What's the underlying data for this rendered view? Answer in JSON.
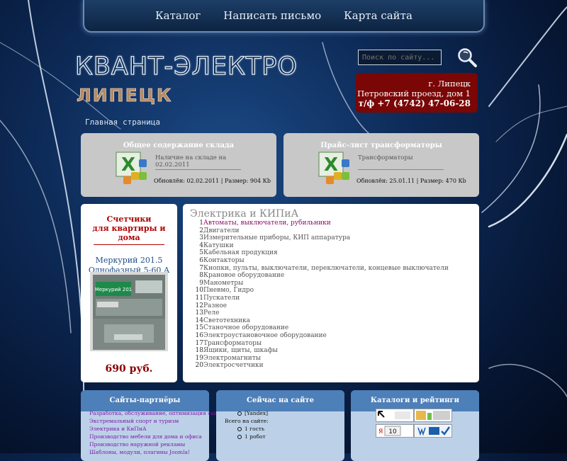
{
  "nav": [
    "Каталог",
    "Написать письмо",
    "Карта сайта"
  ],
  "logo": {
    "title": "КВАНТ-ЭЛЕКТРО",
    "city": "ЛИПЕЦК"
  },
  "search": {
    "placeholder": "Поиск по сайту..."
  },
  "contact": {
    "city": "г. Липецк",
    "address": "Петровский проезд, дом 1",
    "phone": "т/ф +7 (4742) 47-06-28"
  },
  "breadcrumb": "Главная страница",
  "downloads": [
    {
      "title": "Общее содержание склада",
      "desc": "Наличие на складе на 02.02.2011",
      "meta": "Обновлён: 02.02.2011 | Размер: 904 Кb"
    },
    {
      "title": "Прайс-лист трансформаторы",
      "desc": "Трансформаторы",
      "meta": "Обновлён: 25.01.11 | Размер: 470 Кb"
    }
  ],
  "promo": {
    "heading_1": "Счетчики",
    "heading_2": "для квартиры и дома",
    "model_1": "Меркурий 201.5",
    "model_2": "Однофазный 5-60 А",
    "meter_brand": "Меркурий 201",
    "price": "690 руб."
  },
  "catalog": {
    "title": "Электрика и КИПиА",
    "items": [
      "Автоматы, выключатели, рубильники",
      "Двигатели",
      "Измерительные приборы, КИП аппаратура",
      "Катушки",
      "Кабельная продукция",
      "Контакторы",
      "Кнопки, пульты, выключатели, переключатели, концевые выключатели",
      "Крановое оборудование",
      "Манометры",
      "Пневмо, Гидро",
      "Пускатели",
      "Разное",
      "Реле",
      "Светотехника",
      "Станочное оборудование",
      "Электроустановочное оборудование",
      "Трансформаторы",
      "Ящики, щиты, шкафы",
      "Электромагниты",
      "Электросчетчики"
    ]
  },
  "partners": {
    "title": "Сайты-партнёры",
    "links": [
      "Разработка, обслуживание, оптимизация сайтов",
      "Экстремальный спорт и туризм",
      "Электрика и КиПиА",
      "Производство мебели для дома и офиса",
      "Производство наружной рекламы",
      "Шаблоны, модули, плагины Joomla!"
    ]
  },
  "online": {
    "title": "Сейчас на сайте",
    "bot_name": "[Yandex]",
    "total_label": "Всего на сайте:",
    "guests": "1 гость",
    "robots": "1 робот"
  },
  "ratings": {
    "title": "Каталоги и рейтинги",
    "counter_value": "10"
  },
  "colors": {
    "contact_bg": "#7a0606",
    "panel_gray": "#c8c8c8",
    "widget_header": "#4d7fb9",
    "link_purple": "#7d1ca8",
    "price_red": "#8b0000"
  }
}
